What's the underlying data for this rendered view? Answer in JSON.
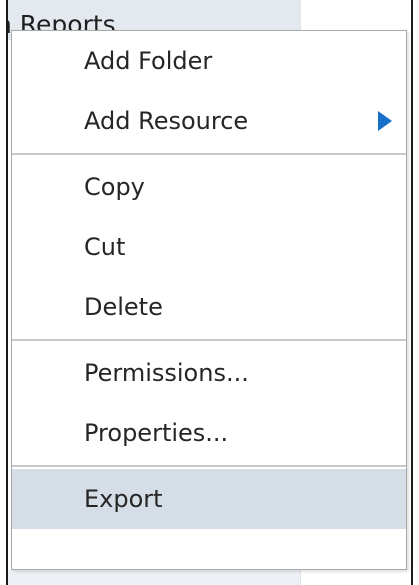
{
  "tree": {
    "partial_label": "n Reports"
  },
  "context_menu": {
    "items": [
      {
        "label": "Add Folder"
      },
      {
        "label": "Add Resource",
        "submenu_icon": "submenu-arrow-icon"
      },
      {
        "label": "Copy"
      },
      {
        "label": "Cut"
      },
      {
        "label": "Delete"
      },
      {
        "label": "Permissions..."
      },
      {
        "label": "Properties..."
      },
      {
        "label": "Export",
        "highlighted": true
      }
    ]
  },
  "colors": {
    "highlight": "#d5dde6",
    "arrow": "#1a6fc9",
    "separator": "#c8c8c8",
    "tree_bg": "#e4e9ef"
  }
}
